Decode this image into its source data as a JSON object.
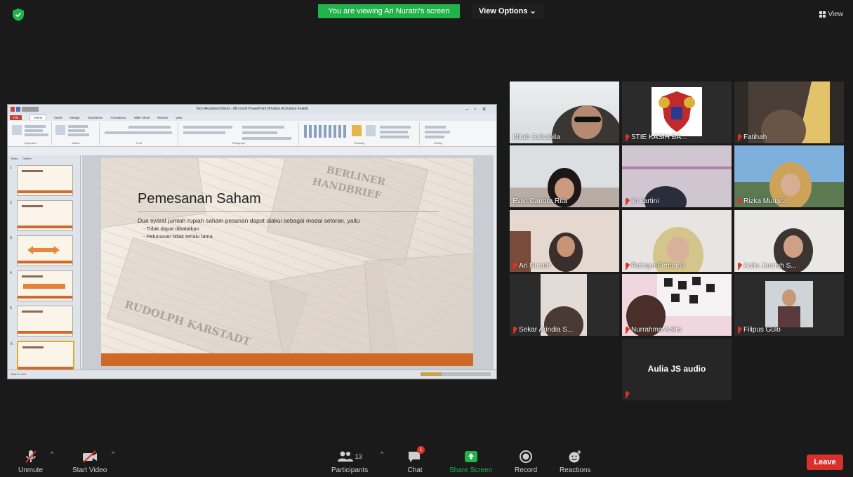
{
  "top": {
    "viewing_banner": "You are viewing Ari Nuratri's screen",
    "view_options": "View Options",
    "view_label": "View"
  },
  "ppt": {
    "window_title": "Teori Akuntansi Bisnis - Microsoft PowerPoint (Product Activation Failed)",
    "tabs": [
      "File",
      "Home",
      "Insert",
      "Design",
      "Transitions",
      "Animations",
      "Slide Show",
      "Review",
      "View"
    ],
    "pane_tabs": [
      "Slides",
      "Outline"
    ],
    "groups": [
      "Clipboard",
      "Slides",
      "Font",
      "Paragraph",
      "Drawing",
      "Editing"
    ],
    "status_left": "Slide 6 of 10",
    "slide_numbers": [
      "1",
      "2",
      "3",
      "4",
      "5",
      "6"
    ]
  },
  "slide": {
    "title": "Pemesanan Saham",
    "body": "Dua syarat jumlah rupiah saham pesanan dapat diakui sebagai modal setoran, yaitu",
    "bullets": [
      "Tidak dapat dibatalkan",
      "Pelunasan tidak terlalu lama"
    ],
    "bg_words": [
      "BERLINER",
      "HANDBRIEF",
      "RUDOLPH KARSTADT"
    ]
  },
  "participants_grid": [
    {
      "name": "Iftitah Salsabila"
    },
    {
      "name": "STIE KASIH BA..."
    },
    {
      "name": "Fatihah"
    },
    {
      "name": "Evlin Candra Rita"
    },
    {
      "name": "iin kartini"
    },
    {
      "name": "Rizka Mutiara"
    },
    {
      "name": "Ari Nuratri"
    },
    {
      "name": "Rahayu Febrianti"
    },
    {
      "name": "Aulia Jannah S..."
    },
    {
      "name": "Sekar Arindia S..."
    },
    {
      "name": "Nurrahma Azkia"
    },
    {
      "name": "Filipus Gulo"
    },
    {
      "name": "Aulia JS audio"
    }
  ],
  "toolbar": {
    "unmute": "Unmute",
    "start_video": "Start Video",
    "participants": "Participants",
    "participants_count": "13",
    "chat": "Chat",
    "share_screen": "Share Screen",
    "record": "Record",
    "reactions": "Reactions",
    "leave": "Leave",
    "chat_badge": "1"
  },
  "colors": {
    "green_banner": "#21b24a",
    "leave_red": "#d8302b",
    "active_outline": "#cfe23a",
    "slide_orange": "#d06928"
  }
}
